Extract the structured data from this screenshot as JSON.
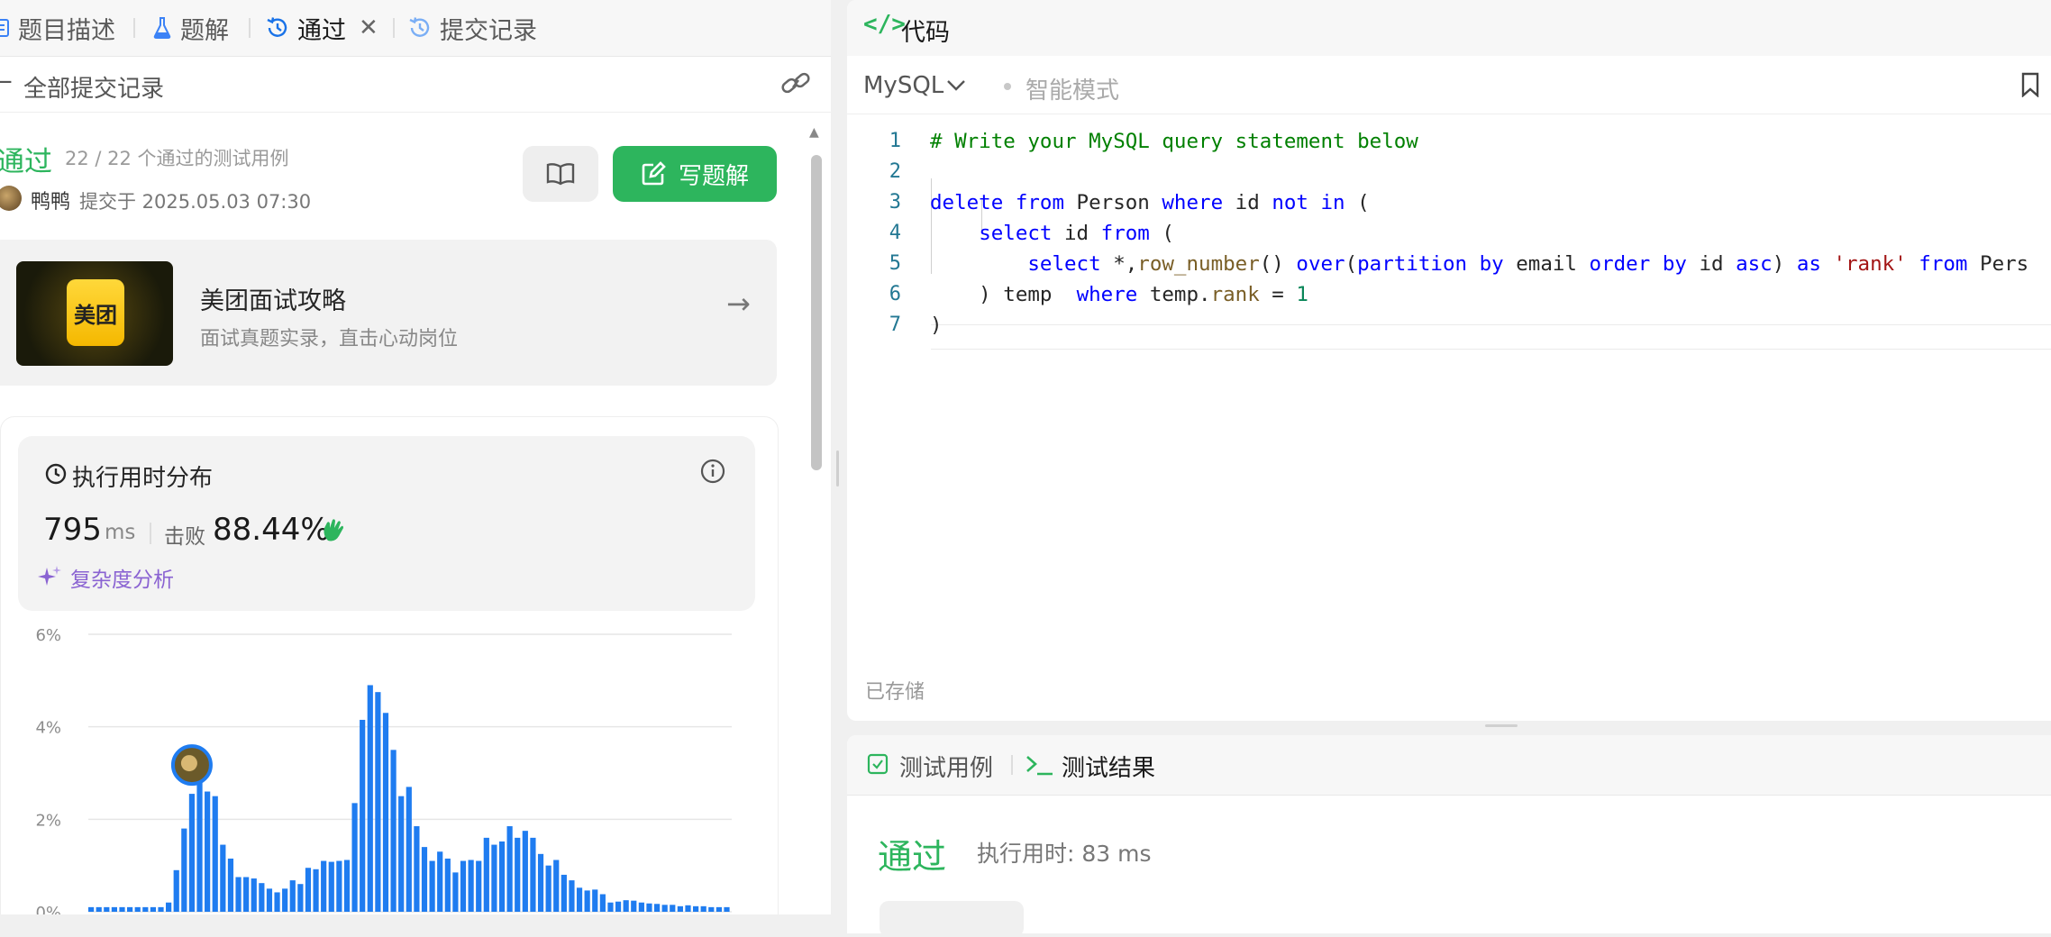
{
  "tabs": [
    {
      "label": "题目描述",
      "icon": "description-icon"
    },
    {
      "label": "题解",
      "icon": "flask-icon"
    },
    {
      "label": "通过",
      "icon": "history-icon",
      "active": true
    },
    {
      "label": "提交记录",
      "icon": "history-icon"
    }
  ],
  "submission": {
    "back_label": "全部提交记录",
    "status": "通过",
    "testcases": "22 / 22 个通过的测试用例",
    "user": "鸭鸭",
    "submitted": "提交于 2025.05.03 07:30",
    "write_solution": "写题解"
  },
  "ad": {
    "logo_text": "美团",
    "title": "美团面试攻略",
    "subtitle": "面试真题实录，直击心动岗位"
  },
  "performance": {
    "title": "执行用时分布",
    "runtime": "795",
    "unit": "ms",
    "beats_label": "击败",
    "beats": "88.44%",
    "complexity_label": "复杂度分析"
  },
  "chart_data": {
    "type": "bar",
    "y_ticks": [
      "6%",
      "4%",
      "2%",
      "0%"
    ],
    "ylim": [
      0,
      6
    ],
    "values": [
      0.1,
      0.1,
      0.1,
      0.1,
      0.1,
      0.1,
      0.1,
      0.1,
      0.1,
      0.1,
      0.2,
      0.9,
      1.8,
      2.55,
      2.8,
      2.6,
      2.5,
      1.45,
      1.15,
      0.75,
      0.75,
      0.72,
      0.62,
      0.5,
      0.42,
      0.5,
      0.68,
      0.6,
      0.95,
      0.92,
      1.1,
      1.08,
      1.1,
      1.12,
      2.35,
      4.15,
      4.9,
      4.75,
      4.3,
      3.5,
      2.5,
      2.7,
      1.85,
      1.4,
      1.1,
      1.3,
      1.15,
      0.85,
      1.1,
      1.12,
      1.1,
      1.6,
      1.45,
      1.52,
      1.85,
      1.6,
      1.75,
      1.6,
      1.25,
      1.0,
      1.12,
      0.8,
      0.68,
      0.52,
      0.46,
      0.48,
      0.38,
      0.2,
      0.22,
      0.25,
      0.24,
      0.2,
      0.18,
      0.17,
      0.15,
      0.15,
      0.12,
      0.14,
      0.12,
      0.12,
      0.1,
      0.1,
      0.1
    ],
    "marker_index": 13
  },
  "editor": {
    "title": "代码",
    "language": "MySQL",
    "mode": "智能模式",
    "saved": "已存储",
    "line_numbers": [
      "1",
      "2",
      "3",
      "4",
      "5",
      "6",
      "7"
    ],
    "lines": [
      "# Write your MySQL query statement below",
      "",
      "delete from Person where id not in (",
      "    select id from (",
      "        select *,row_number() over(partition by email order by id asc) as 'rank' from Pers",
      "    ) temp  where temp.rank = 1",
      ")"
    ]
  },
  "results": {
    "testcase_tab": "测试用例",
    "result_tab": "测试结果",
    "status": "通过",
    "runtime": "执行用时: 83 ms"
  },
  "colors": {
    "accent_green": "#2db55d",
    "bar_blue": "#1f7cf0",
    "link_purple": "#8a63d2"
  }
}
